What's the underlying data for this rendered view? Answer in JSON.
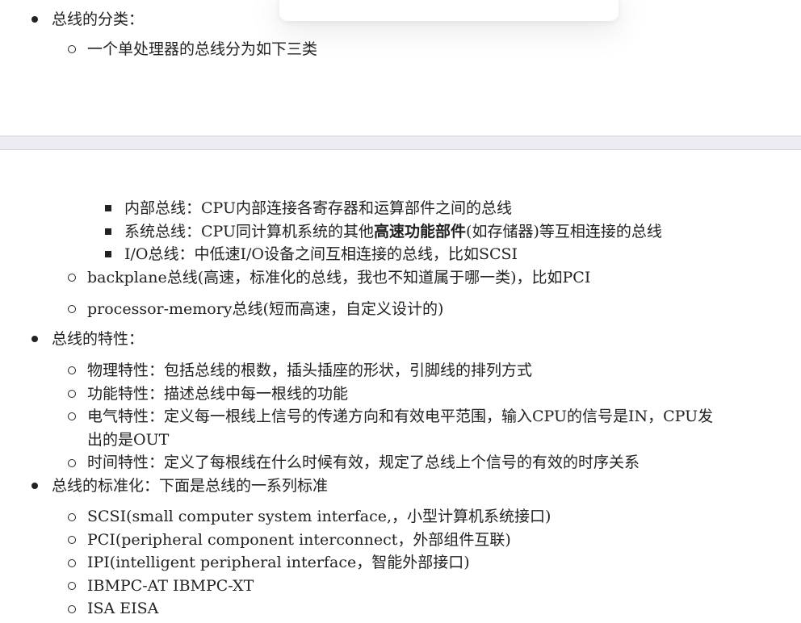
{
  "top": {
    "bus_classification": "总线的分类：",
    "single_processor_types": "一个单处理器的总线分为如下三类"
  },
  "classification": {
    "internal_bus": "内部总线：CPU内部连接各寄存器和运算部件之间的总线",
    "system_bus_prefix": "系统总线：CPU同计算机系统的其他",
    "system_bus_bold": "高速功能部件",
    "system_bus_suffix": "(如存储器)等互相连接的总线",
    "io_bus": "I/O总线：中低速I/O设备之间互相连接的总线，比如SCSI",
    "backplane_bus": "backplane总线(高速，标准化的总线，我也不知道属于哪一类)，比如PCI",
    "processor_memory_bus": "processor-memory总线(短而高速，自定义设计的)"
  },
  "characteristics": {
    "heading": "总线的特性：",
    "physical": "物理特性：包括总线的根数，插头插座的形状，引脚线的排列方式",
    "functional": "功能特性：描述总线中每一根线的功能",
    "electrical_line1": "电气特性：定义每一根线上信号的传递方向和有效电平范围，输入CPU的信号是IN，CPU发",
    "electrical_line2": "出的是OUT",
    "timing": "时间特性：定义了每根线在什么时候有效，规定了总线上个信号的有效的时序关系"
  },
  "standardization": {
    "heading": "总线的标准化：下面是总线的一系列标准",
    "scsi": "SCSI(small computer system interface,，小型计算机系统接口)",
    "pci": "PCI(peripheral component interconnect，外部组件互联)",
    "ipi": "IPI(intelligent peripheral interface，智能外部接口)",
    "ibmpc": "IBMPC-AT IBMPC-XT",
    "isa": "ISA EISA"
  }
}
